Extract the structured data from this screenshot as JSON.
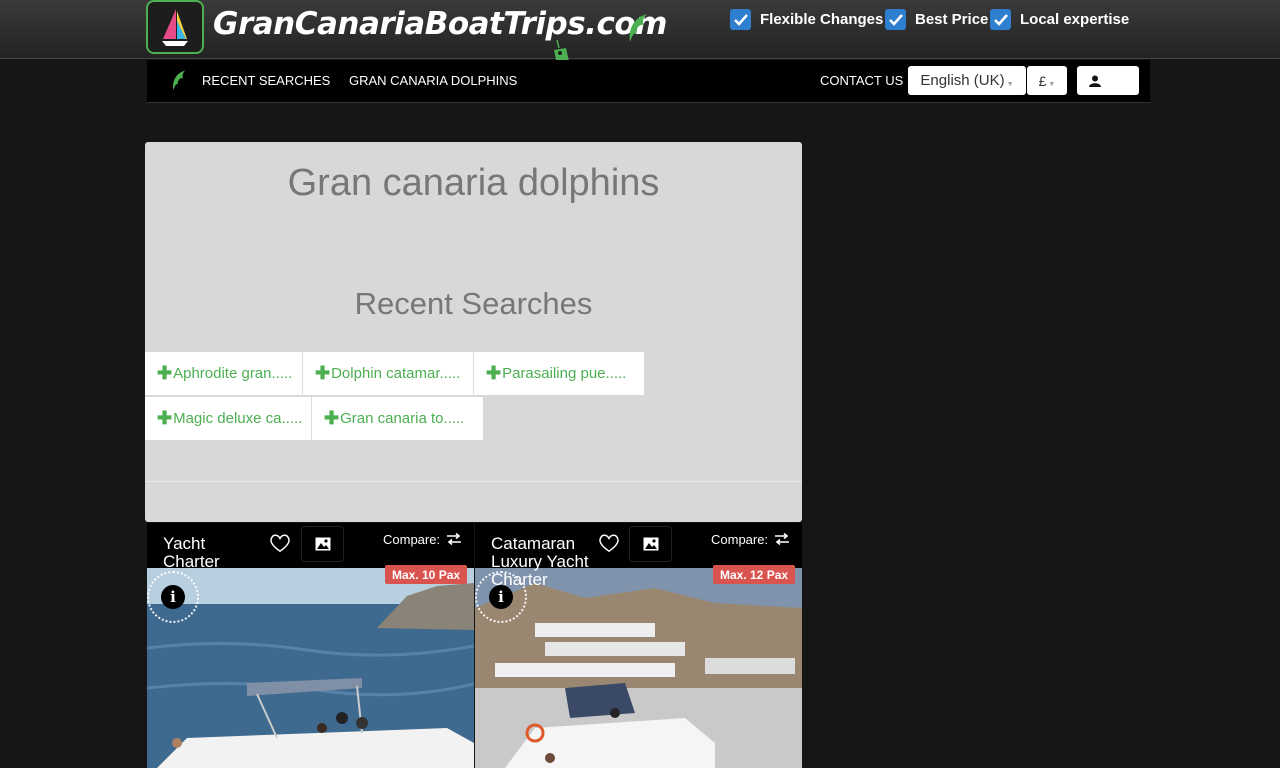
{
  "brand": {
    "name": "GranCanariaBoatTrips.com"
  },
  "features": [
    {
      "label": "Flexible Changes"
    },
    {
      "label": "Best Price"
    },
    {
      "label": "Local expertise"
    }
  ],
  "nav": {
    "links": [
      {
        "label": "RECENT SEARCHES"
      },
      {
        "label": "GRAN CANARIA DOLPHINS"
      }
    ],
    "contact": "CONTACT US",
    "language": "English (UK)",
    "currency": "£"
  },
  "panel": {
    "title": "Gran canaria dolphins",
    "recent_title": "Recent Searches",
    "chips": [
      {
        "label": "Aphrodite gran....."
      },
      {
        "label": "Dolphin catamar....."
      },
      {
        "label": "Parasailing pue....."
      },
      {
        "label": "Magic deluxe ca....."
      },
      {
        "label": "Gran canaria to....."
      }
    ]
  },
  "cards": [
    {
      "title": "Yacht Charter",
      "compare": "Compare:",
      "max_pax": "Max. 10 Pax"
    },
    {
      "title": "Catamaran Luxury Yacht Charter",
      "compare": "Compare:",
      "max_pax": "Max. 12 Pax"
    }
  ],
  "colors": {
    "accent_green": "#4caf50",
    "check_blue": "#2f7fd1",
    "badge_red": "#d9534f"
  }
}
